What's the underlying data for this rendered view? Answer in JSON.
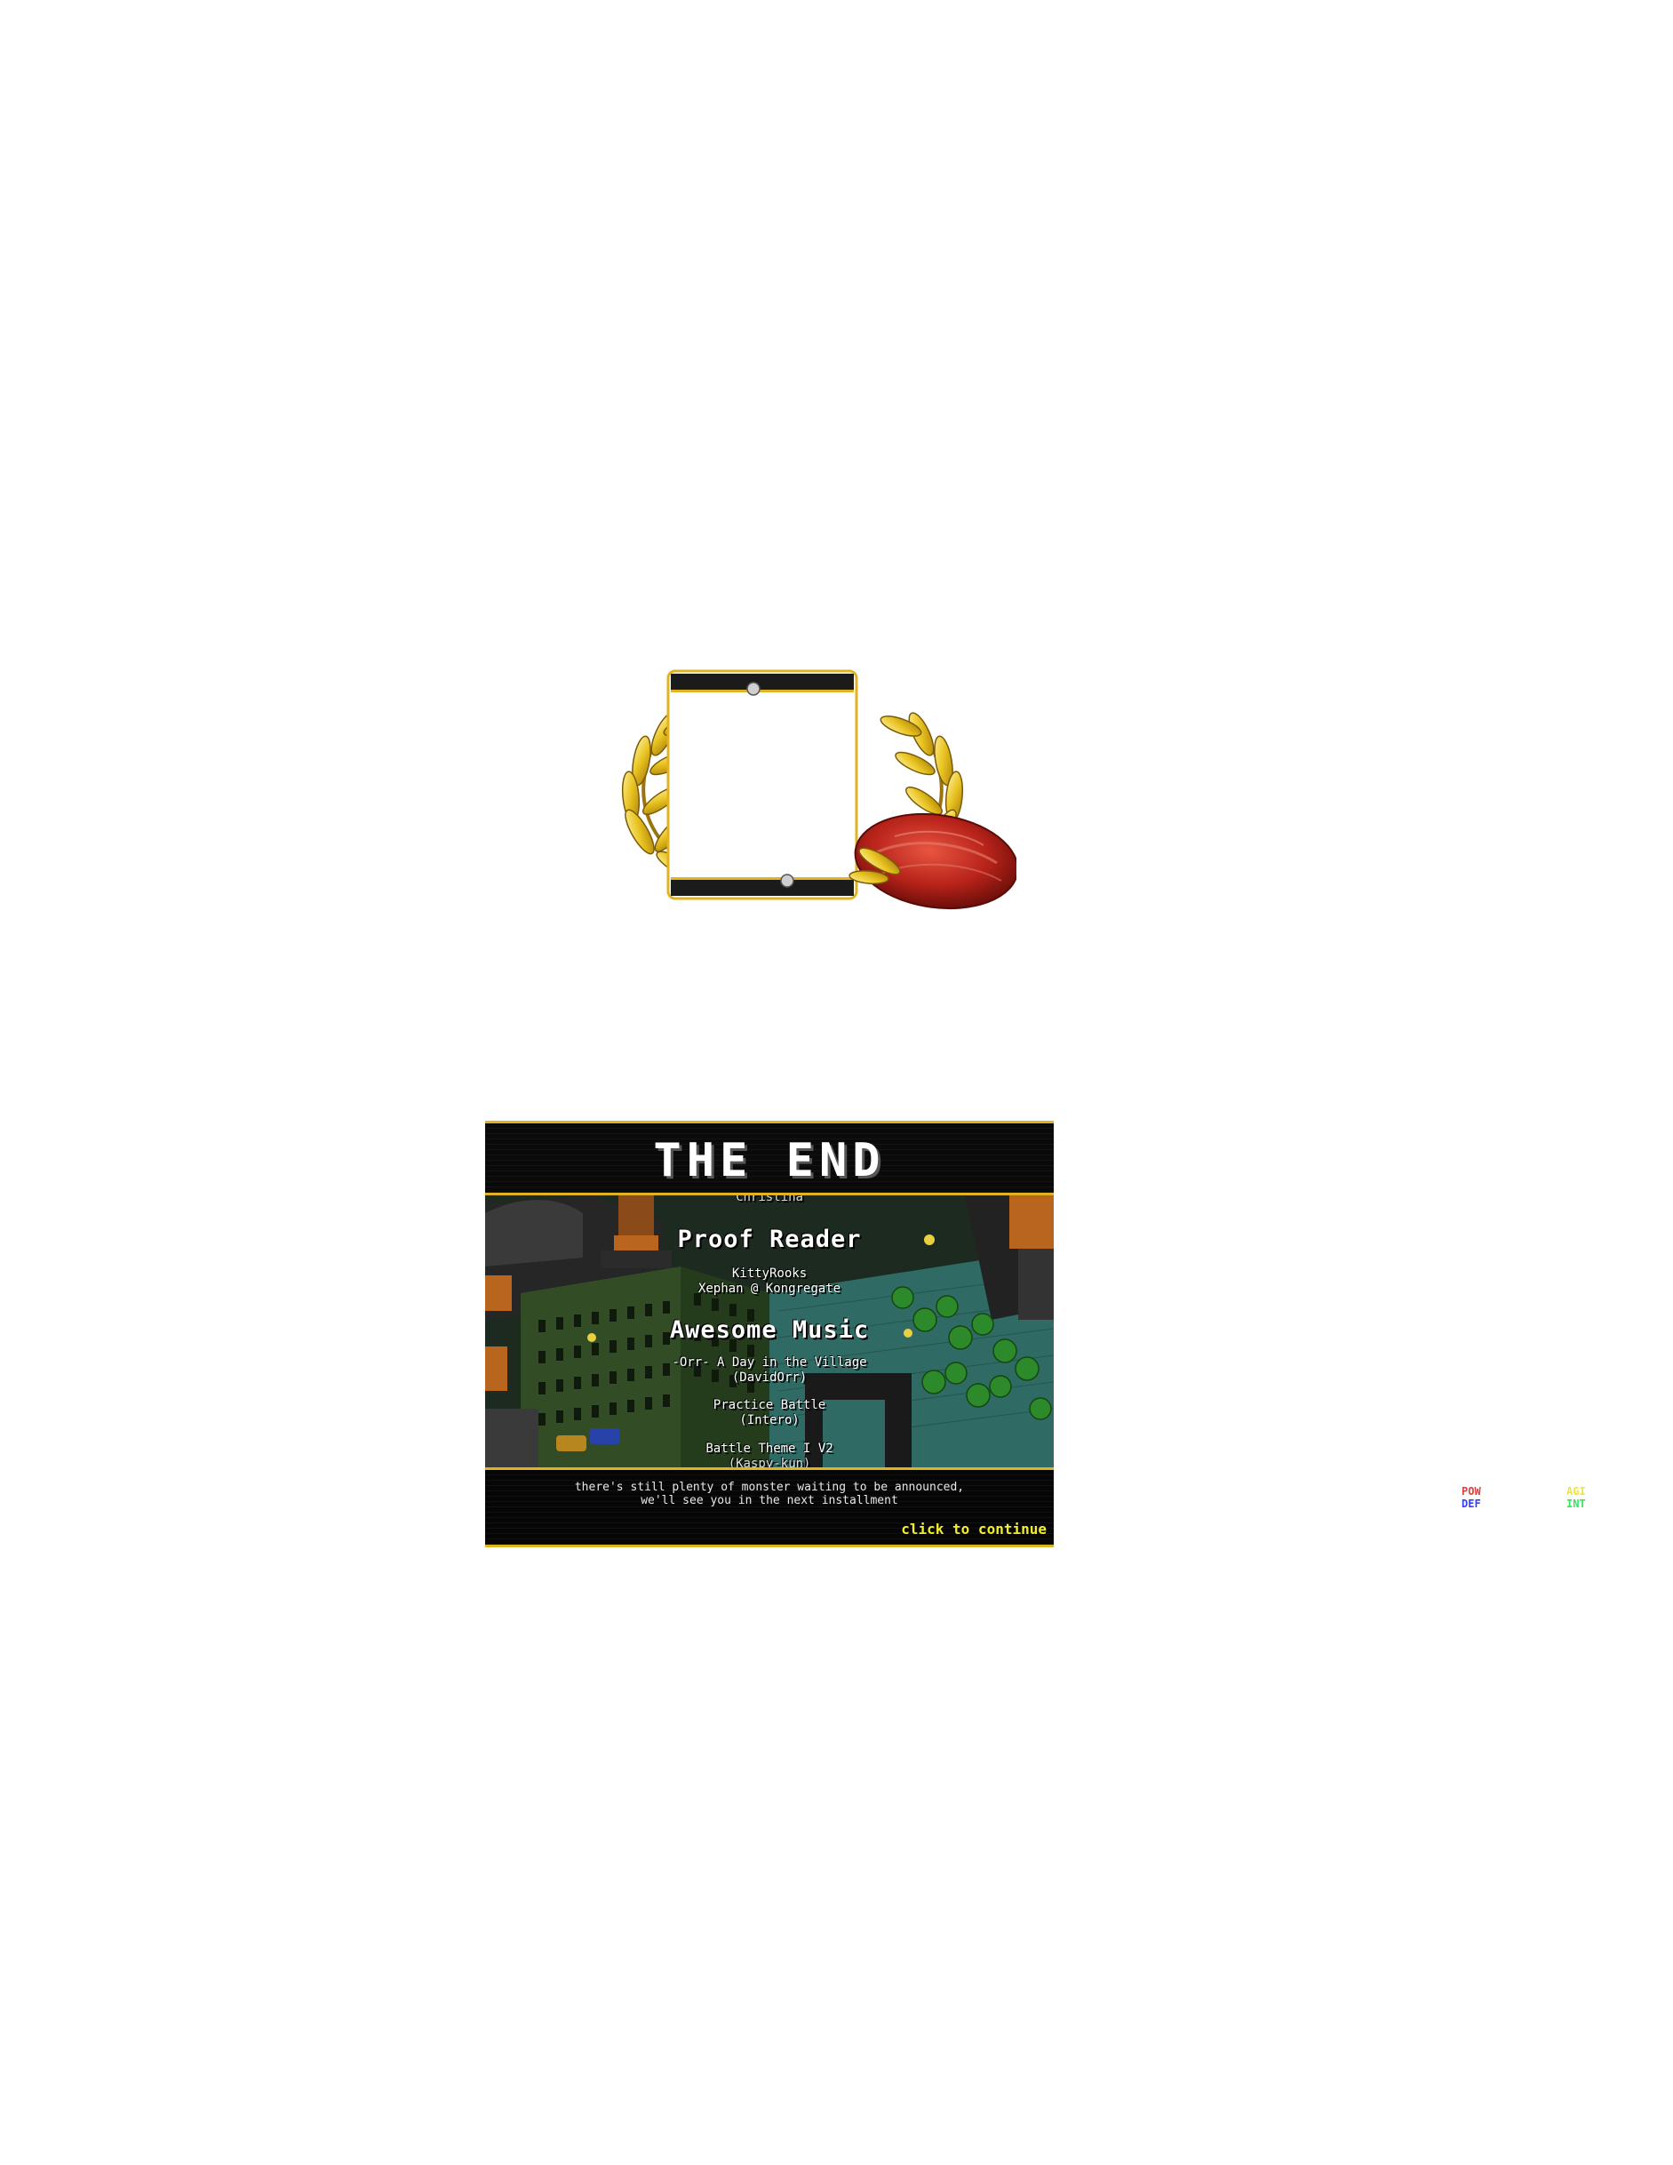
{
  "credits_screen": {
    "title": "THE END",
    "roll": [
      {
        "type": "cut",
        "text": "Christina"
      },
      {
        "type": "heading",
        "text": "Proof Reader"
      },
      {
        "type": "name",
        "text": "KittyRooks"
      },
      {
        "type": "name",
        "text": "Xephan @ Kongregate"
      },
      {
        "type": "heading",
        "text": "Awesome Music"
      },
      {
        "type": "name",
        "text": "-Orr- A Day in the Village"
      },
      {
        "type": "name",
        "text": "(DavidOrr)"
      },
      {
        "type": "name",
        "text": "Practice Battle"
      },
      {
        "type": "name",
        "text": "(Intero)"
      },
      {
        "type": "name",
        "text": "Battle Theme I V2"
      },
      {
        "type": "cut",
        "text": "(Kaspy-kun)"
      }
    ],
    "notice_line1": "there's still plenty of monster waiting to be announced,",
    "notice_line2": "we'll see you in the next installment",
    "continue_label": "click to continue"
  },
  "stats": {
    "pow": "POW",
    "def": "DEF",
    "agi": "AGI",
    "int": "INT"
  },
  "colors": {
    "frame_gold": "#e0b323",
    "laurel_gold": "#e8c21f",
    "seal_red": "#b8231a",
    "continue_yellow": "#f2ee2e",
    "pow": "#e83a3a",
    "def": "#3a3aff",
    "agi": "#f0e53a",
    "int": "#33e65a"
  }
}
